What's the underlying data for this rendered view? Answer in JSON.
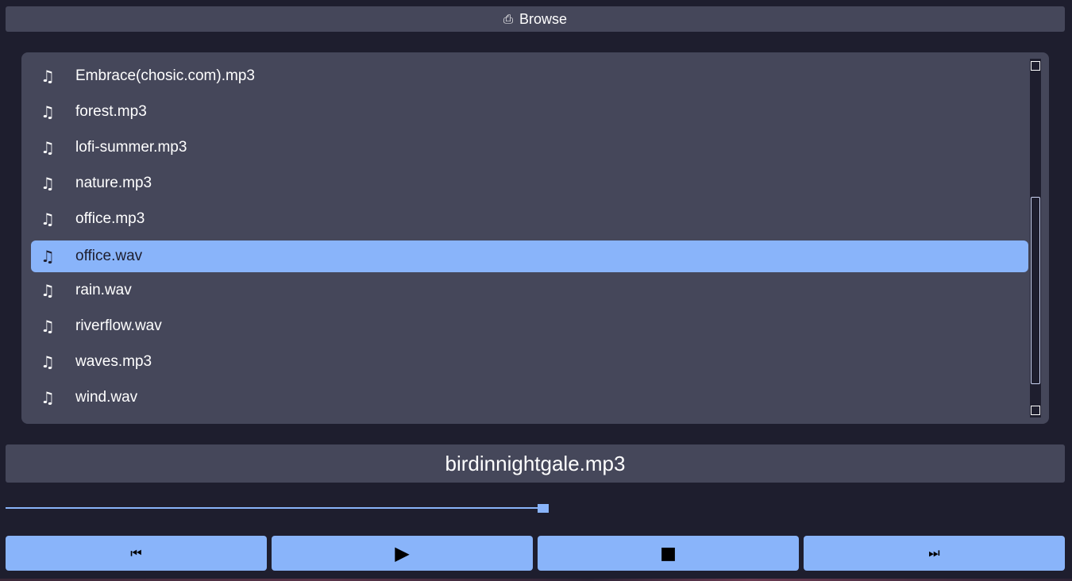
{
  "browse": {
    "icon": "⎙",
    "label": "Browse"
  },
  "playlist": {
    "items": [
      {
        "icon": "♫",
        "name": "Embrace(chosic.com).mp3"
      },
      {
        "icon": "♫",
        "name": "forest.mp3"
      },
      {
        "icon": "♫",
        "name": "lofi-summer.mp3"
      },
      {
        "icon": "♫",
        "name": "nature.mp3"
      },
      {
        "icon": "♫",
        "name": "office.mp3"
      },
      {
        "icon": "♫",
        "name": "office.wav"
      },
      {
        "icon": "♫",
        "name": "rain.wav"
      },
      {
        "icon": "♫",
        "name": "riverflow.wav"
      },
      {
        "icon": "♫",
        "name": "waves.mp3"
      },
      {
        "icon": "♫",
        "name": "wind.wav"
      }
    ],
    "selected_index": 5
  },
  "now_playing": {
    "title": "birdinnightgale.mp3"
  },
  "progress": {
    "fraction": 0.5
  },
  "controls": {
    "prev": "⏮",
    "play": "▶",
    "stop": "■",
    "next": "⏭"
  },
  "colors": {
    "background": "#1e1e2e",
    "surface": "#45475a",
    "accent": "#89b4fa"
  }
}
